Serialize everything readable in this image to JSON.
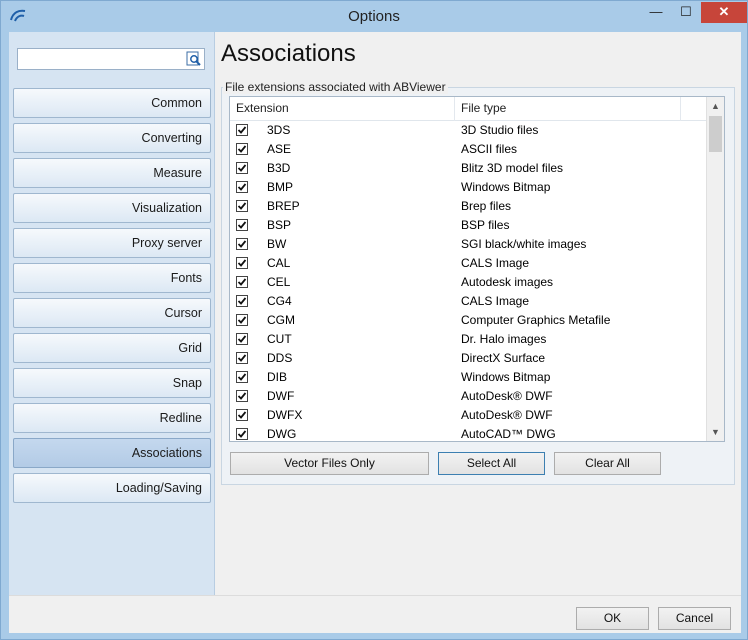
{
  "window": {
    "title": "Options"
  },
  "search": {
    "value": "",
    "placeholder": ""
  },
  "sidebar": {
    "items": [
      {
        "label": "Common"
      },
      {
        "label": "Converting"
      },
      {
        "label": "Measure"
      },
      {
        "label": "Visualization"
      },
      {
        "label": "Proxy server"
      },
      {
        "label": "Fonts"
      },
      {
        "label": "Cursor"
      },
      {
        "label": "Grid"
      },
      {
        "label": "Snap"
      },
      {
        "label": "Redline"
      },
      {
        "label": "Associations",
        "active": true
      },
      {
        "label": "Loading/Saving"
      }
    ]
  },
  "page": {
    "title": "Associations",
    "group_label": "File extensions associated with ABViewer",
    "columns": [
      "Extension",
      "File type"
    ],
    "rows": [
      {
        "ext": "3DS",
        "type": "3D Studio files",
        "checked": true
      },
      {
        "ext": "ASE",
        "type": "ASCII files",
        "checked": true
      },
      {
        "ext": "B3D",
        "type": "Blitz 3D model files",
        "checked": true
      },
      {
        "ext": "BMP",
        "type": "Windows Bitmap",
        "checked": true
      },
      {
        "ext": "BREP",
        "type": "Brep files",
        "checked": true
      },
      {
        "ext": "BSP",
        "type": "BSP files",
        "checked": true
      },
      {
        "ext": "BW",
        "type": "SGI black/white images",
        "checked": true
      },
      {
        "ext": "CAL",
        "type": "CALS Image",
        "checked": true
      },
      {
        "ext": "CEL",
        "type": "Autodesk images",
        "checked": true
      },
      {
        "ext": "CG4",
        "type": "CALS Image",
        "checked": true
      },
      {
        "ext": "CGM",
        "type": "Computer Graphics Metafile",
        "checked": true
      },
      {
        "ext": "CUT",
        "type": "Dr. Halo images",
        "checked": true
      },
      {
        "ext": "DDS",
        "type": "DirectX Surface",
        "checked": true
      },
      {
        "ext": "DIB",
        "type": "Windows Bitmap",
        "checked": true
      },
      {
        "ext": "DWF",
        "type": "AutoDesk® DWF",
        "checked": true
      },
      {
        "ext": "DWFX",
        "type": "AutoDesk® DWF",
        "checked": true
      },
      {
        "ext": "DWG",
        "type": "AutoCAD™ DWG",
        "checked": true
      }
    ],
    "buttons": {
      "vector_files_only": "Vector Files Only",
      "select_all": "Select All",
      "clear_all": "Clear All"
    }
  },
  "footer": {
    "ok": "OK",
    "cancel": "Cancel"
  },
  "colors": {
    "accent": "#a9cbe8",
    "sidebar_bg": "#d6e4f2",
    "close_button": "#c7453a"
  },
  "icons": {
    "app": "abviewer-app-icon",
    "search": "search-icon",
    "check": "checkmark-icon"
  }
}
